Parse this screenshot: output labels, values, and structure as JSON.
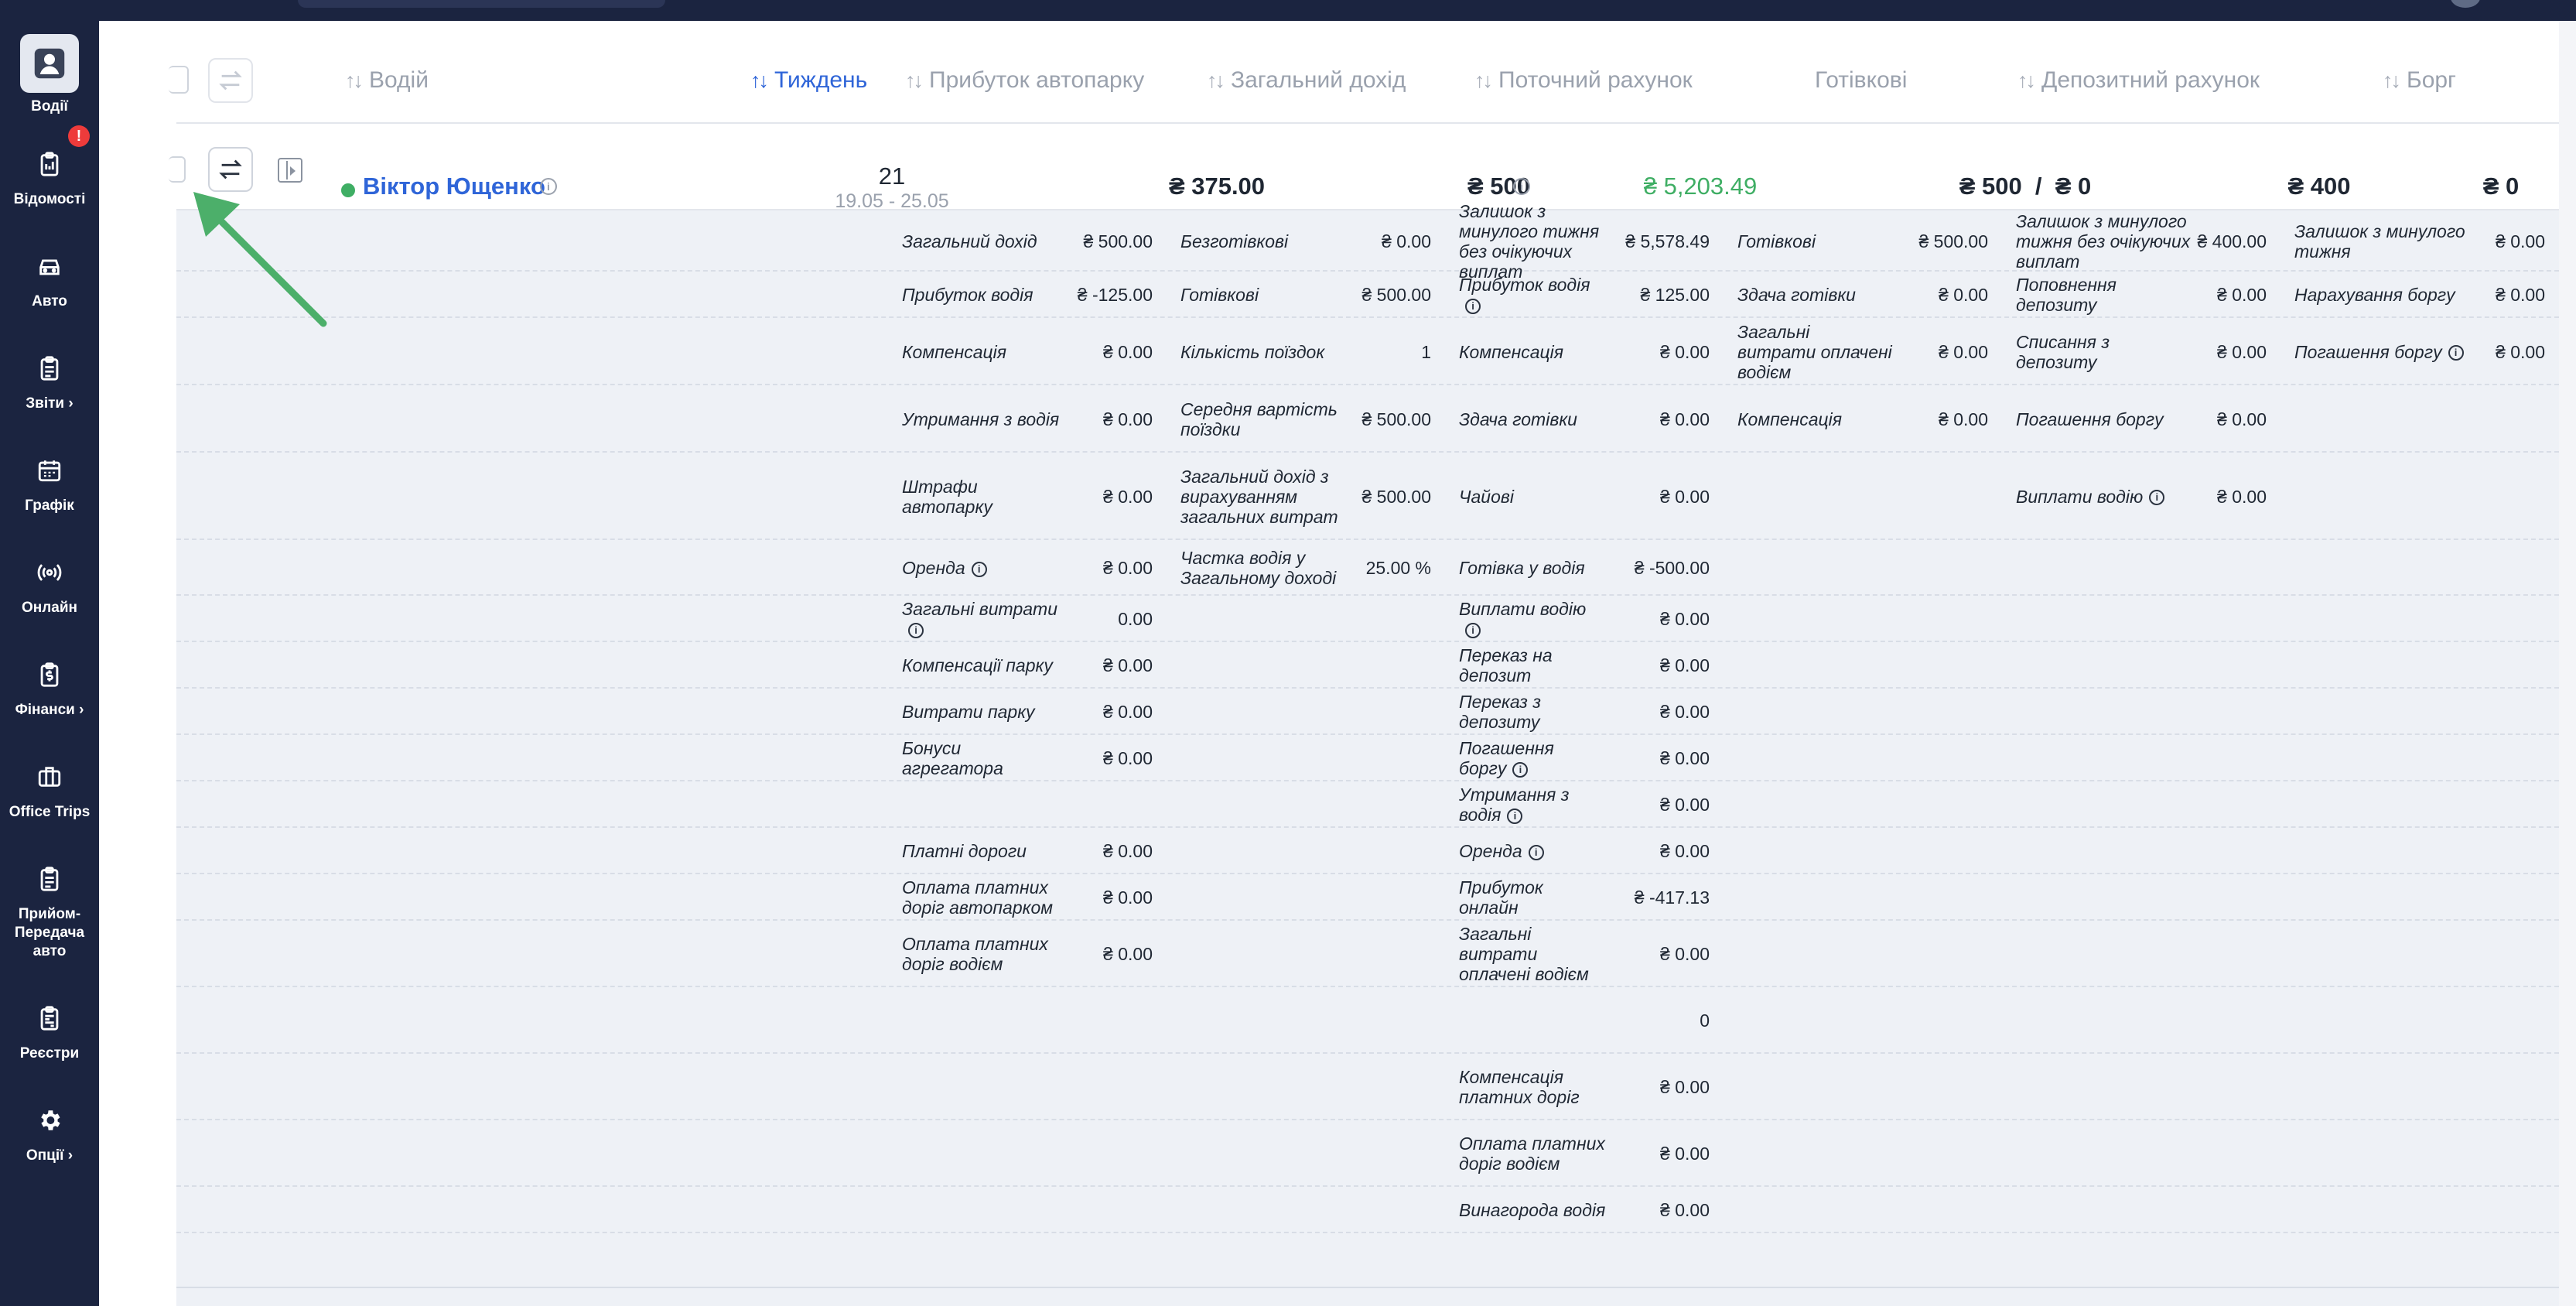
{
  "sidebar": {
    "items": [
      {
        "label": "Водії",
        "icon": "person-icon",
        "active": true
      },
      {
        "label": "Відомості",
        "icon": "clipboard-icon",
        "badge": "!"
      },
      {
        "label": "Авто",
        "icon": "car-icon"
      },
      {
        "label": "Звіти ›",
        "icon": "report-icon"
      },
      {
        "label": "Графік",
        "icon": "calendar-icon"
      },
      {
        "label": "Онлайн",
        "icon": "broadcast-icon"
      },
      {
        "label": "Фінанси ›",
        "icon": "finance-icon"
      },
      {
        "label": "Office Trips",
        "icon": "briefcase-icon"
      },
      {
        "label": "Прийом-Передача авто",
        "icon": "handover-icon"
      },
      {
        "label": "Реєстри",
        "icon": "registry-icon"
      },
      {
        "label": "Опції ›",
        "icon": "gear-icon"
      }
    ]
  },
  "table": {
    "headers": {
      "driver": "Водій",
      "week": "Тиждень",
      "fleet_profit": "Прибуток автопарку",
      "total_income": "Загальний дохід",
      "current_account": "Поточний рахунок",
      "cash": "Готівкові",
      "deposit_account": "Депозитний рахунок",
      "debt": "Борг"
    },
    "row": {
      "driver_name": "Віктор Ющенко",
      "week_number": "21",
      "week_range": "19.05 - 25.05",
      "fleet_profit": "₴ 375.00",
      "total_income": "₴ 500",
      "current_account": "₴ 5,203.49",
      "cash": "₴ 500  /  ₴ 0",
      "deposit_account": "₴ 400",
      "debt": "₴ 0"
    }
  },
  "details": {
    "col1": [
      {
        "label": "Загальний дохід",
        "value": "₴ 500.00"
      },
      {
        "label": "Прибуток водія",
        "value": "₴ -125.00"
      },
      {
        "label": "Компенсація",
        "value": "₴ 0.00"
      },
      {
        "label": "Утримання з водія",
        "value": "₴ 0.00"
      },
      {
        "label": "Штрафи автопарку",
        "value": "₴ 0.00"
      },
      {
        "label": "Оренда",
        "value": "₴ 0.00",
        "info": true
      },
      {
        "label": "Загальні витрати",
        "value": "0.00",
        "info": true
      },
      {
        "label": "Компенсації парку",
        "value": "₴ 0.00"
      },
      {
        "label": "Витрати парку",
        "value": "₴ 0.00"
      },
      {
        "label": "Бонуси агрегатора",
        "value": "₴ 0.00"
      },
      {
        "label": "",
        "value": ""
      },
      {
        "label": "Платні дороги",
        "value": "₴ 0.00"
      },
      {
        "label": "Оплата платних доріг автопарком",
        "value": "₴ 0.00"
      },
      {
        "label": "Оплата платних доріг водієм",
        "value": "₴ 0.00"
      }
    ],
    "col2": [
      {
        "label": "Безготівкові",
        "value": "₴ 0.00"
      },
      {
        "label": "Готівкові",
        "value": "₴ 500.00"
      },
      {
        "label": "Кількість поїздок",
        "value": "1"
      },
      {
        "label": "Середня вартість поїздки",
        "value": "₴ 500.00"
      },
      {
        "label": "Загальний дохід з вирахуванням загальних витрат",
        "value": "₴ 500.00"
      },
      {
        "label": "Частка водія у Загальному доході",
        "value": "25.00 %"
      }
    ],
    "col3": [
      {
        "label": "Залишок з минулого тижня без очікуючих виплат",
        "value": "₴ 5,578.49"
      },
      {
        "label": "Прибуток водія",
        "value": "₴ 125.00",
        "info": true
      },
      {
        "label": "Компенсація",
        "value": "₴ 0.00"
      },
      {
        "label": "Здача готівки",
        "value": "₴ 0.00"
      },
      {
        "label": "Чайові",
        "value": "₴ 0.00"
      },
      {
        "label": "Готівка у водія",
        "value": "₴ -500.00"
      },
      {
        "label": "Виплати водію",
        "value": "₴ 0.00",
        "info": true
      },
      {
        "label": "Переказ на депозит",
        "value": "₴ 0.00"
      },
      {
        "label": "Переказ з депозиту",
        "value": "₴ 0.00"
      },
      {
        "label": "Погашення боргу",
        "value": "₴ 0.00",
        "info": true
      },
      {
        "label": "Утримання з водія",
        "value": "₴ 0.00",
        "info": true
      },
      {
        "label": "Оренда",
        "value": "₴ 0.00",
        "info": true
      },
      {
        "label": "Прибуток онлайн",
        "value": "₴ -417.13"
      },
      {
        "label": "Загальні витрати оплачені водієм",
        "value": "₴ 0.00"
      },
      {
        "label": "",
        "value": "0"
      },
      {
        "label": "Компенсація платних доріг",
        "value": "₴ 0.00"
      },
      {
        "label": "Оплата платних доріг водієм",
        "value": "₴ 0.00"
      },
      {
        "label": "Винагорода водія",
        "value": "₴ 0.00"
      }
    ],
    "col4": [
      {
        "label": "Готівкові",
        "value": "₴ 500.00"
      },
      {
        "label": "Здача готівки",
        "value": "₴ 0.00"
      },
      {
        "label": "Загальні витрати оплачені водієм",
        "value": "₴ 0.00"
      },
      {
        "label": "Компенсація",
        "value": "₴ 0.00"
      }
    ],
    "col5": [
      {
        "label": "Залишок з минулого тижня без очікуючих виплат",
        "value": "₴ 400.00"
      },
      {
        "label": "Поповнення депозиту",
        "value": "₴ 0.00"
      },
      {
        "label": "Списання з депозиту",
        "value": "₴ 0.00"
      },
      {
        "label": "Погашення боргу",
        "value": "₴ 0.00"
      },
      {
        "label": "Виплати водію",
        "value": "₴ 0.00",
        "info": true
      }
    ],
    "col6": [
      {
        "label": "Залишок з минулого тижня",
        "value": "₴ 0.00"
      },
      {
        "label": "Нарахування боргу",
        "value": "₴ 0.00"
      },
      {
        "label": "Погашення боргу",
        "value": "₴ 0.00",
        "info": true
      }
    ]
  },
  "colors": {
    "sidebar": "#1b2440",
    "accent": "#2f65d8",
    "positive": "#3fae64",
    "alert": "#ee3b3b",
    "arrow": "#4caf6a"
  }
}
